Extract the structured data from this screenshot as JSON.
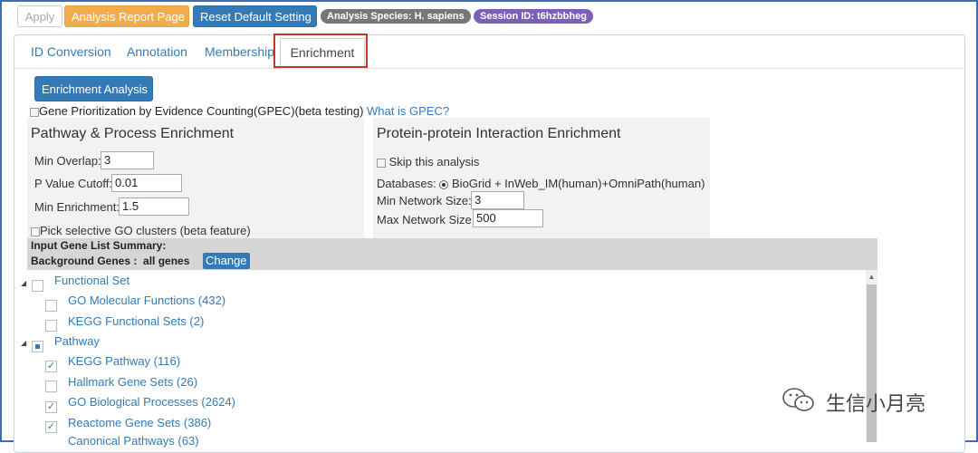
{
  "toolbar": {
    "apply_label": "Apply",
    "report_label": "Analysis Report Page",
    "reset_label": "Reset Default Setting",
    "species_badge": "Analysis Species: H. sapiens",
    "session_badge": "Session ID: t6hzbbheg"
  },
  "tabs": [
    {
      "label": "ID Conversion"
    },
    {
      "label": "Annotation"
    },
    {
      "label": "Membership"
    },
    {
      "label": "Enrichment",
      "active": true
    }
  ],
  "enrichment_button": "Enrichment Analysis",
  "gpec": {
    "label": "Gene Prioritization by Evidence Counting(GPEC)(beta testing)",
    "link": "What is GPEC?"
  },
  "pathway": {
    "title": "Pathway & Process Enrichment",
    "min_overlap_label": "Min Overlap:",
    "min_overlap_value": "3",
    "pvalue_label": "P Value Cutoff:",
    "pvalue_value": "0.01",
    "min_enrichment_label": "Min Enrichment:",
    "min_enrichment_value": "1.5",
    "go_clusters_label": "Pick selective GO clusters (beta feature)"
  },
  "ppi": {
    "title": "Protein-protein Interaction Enrichment",
    "skip_label": "Skip this analysis",
    "databases_label": "Databases:",
    "databases_value": "BioGrid + InWeb_IM(human)+OmniPath(human)",
    "min_network_label": "Min Network Size:",
    "min_network_value": "3",
    "max_network_label": "Max Network Size:",
    "max_network_value": "500"
  },
  "summary": {
    "line1": "Input Gene List Summary:",
    "line2_label": "Background Genes :",
    "line2_value": "all genes",
    "change_label": "Change"
  },
  "tree": [
    {
      "label": "Functional Set",
      "level": 0,
      "state": "unchecked"
    },
    {
      "label": "GO Molecular Functions (432)",
      "level": 1,
      "state": "unchecked"
    },
    {
      "label": "KEGG Functional Sets (2)",
      "level": 1,
      "state": "unchecked"
    },
    {
      "label": "Pathway",
      "level": 0,
      "state": "partial"
    },
    {
      "label": "KEGG Pathway (116)",
      "level": 1,
      "state": "checked"
    },
    {
      "label": "Hallmark Gene Sets (26)",
      "level": 1,
      "state": "unchecked"
    },
    {
      "label": "GO Biological Processes (2624)",
      "level": 1,
      "state": "checked"
    },
    {
      "label": "Reactome Gene Sets (386)",
      "level": 1,
      "state": "checked"
    },
    {
      "label": "Canonical Pathways (63)",
      "level": 1,
      "state": "checked"
    }
  ],
  "watermark": "生信小月亮",
  "colors": {
    "primary": "#337ab7",
    "warning": "#f0ad4e",
    "badge_gray": "#777777",
    "badge_purple": "#7c5fb7",
    "highlight_red": "#c0392b",
    "frame_blue": "#3c6cb4"
  }
}
